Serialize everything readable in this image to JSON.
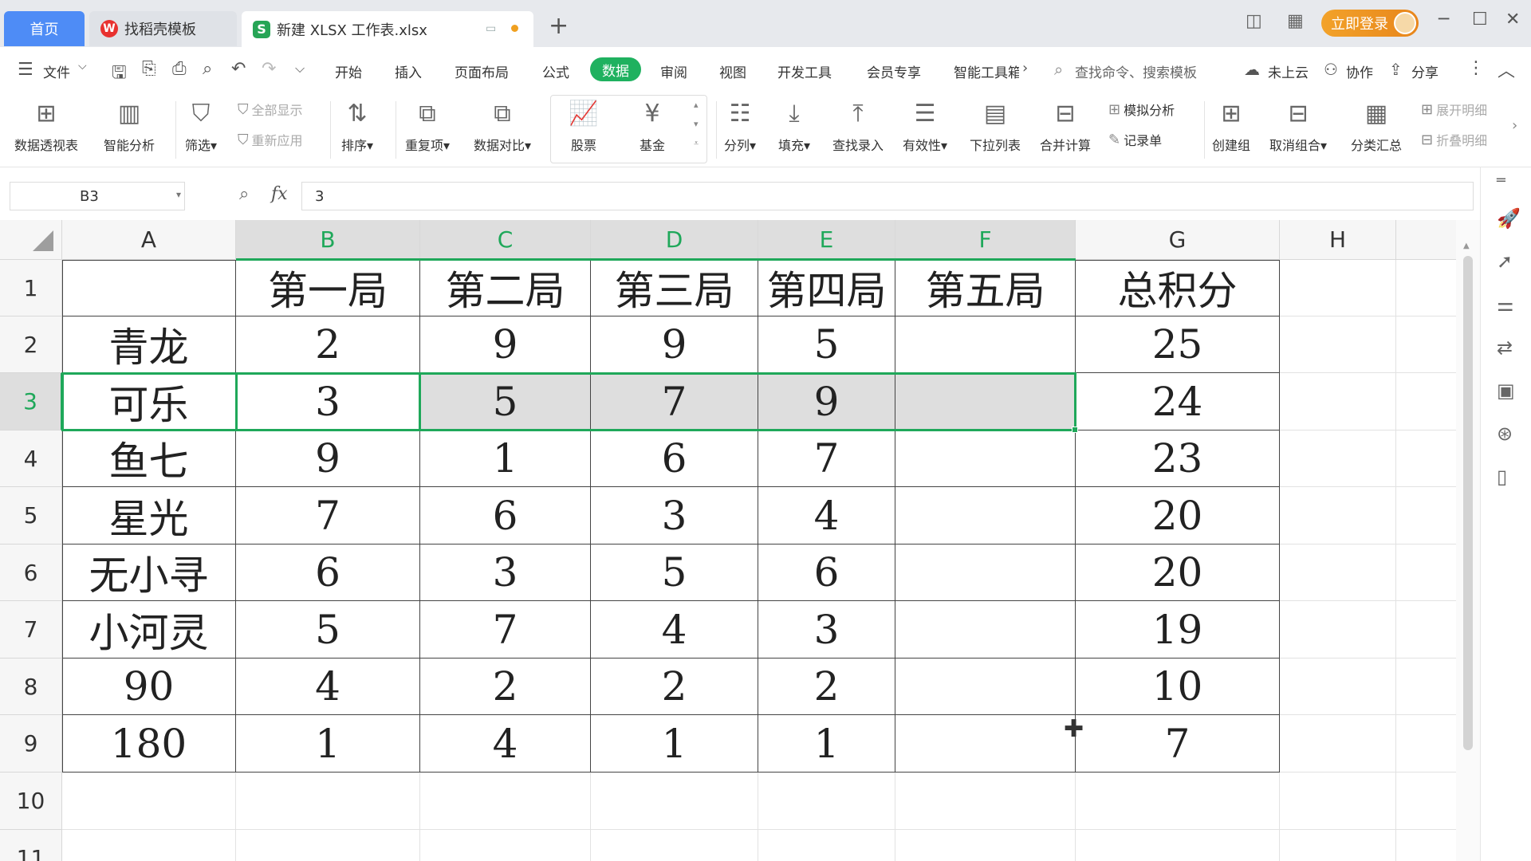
{
  "tabs": {
    "home": "首页",
    "template": "找稻壳模板",
    "document": "新建 XLSX 工作表.xlsx",
    "add": "+"
  },
  "topbar": {
    "login": "立即登录"
  },
  "menu": {
    "file": "文件",
    "items": [
      "开始",
      "插入",
      "页面布局",
      "公式",
      "数据",
      "审阅",
      "视图",
      "开发工具",
      "会员专享",
      "智能工具箱"
    ],
    "active": "数据",
    "search": "查找命令、搜索模板",
    "cloud": "未上云",
    "collab": "协作",
    "share": "分享"
  },
  "ribbon": {
    "pivot": "数据透视表",
    "smart_analysis": "智能分析",
    "filter": "筛选",
    "show_all": "全部显示",
    "reapply": "重新应用",
    "sort": "排序",
    "duplicates": "重复项",
    "compare": "数据对比",
    "stock": "股票",
    "fund": "基金",
    "split": "分列",
    "fill": "填充",
    "lookup": "查找录入",
    "validity": "有效性",
    "dropdown": "下拉列表",
    "consolidate": "合并计算",
    "simulate": "模拟分析",
    "record": "记录单",
    "create_group": "创建组",
    "ungroup": "取消组合",
    "subtotal": "分类汇总",
    "expand": "展开明细",
    "collapse": "折叠明细"
  },
  "formula_bar": {
    "name_box": "B3",
    "fx": "fx",
    "value": "3"
  },
  "sheet": {
    "columns": [
      "A",
      "B",
      "C",
      "D",
      "E",
      "F",
      "G",
      "H"
    ],
    "row_numbers": [
      "1",
      "2",
      "3",
      "4",
      "5",
      "6",
      "7",
      "8",
      "9",
      "10",
      "11"
    ],
    "rows": [
      [
        "",
        "第一局",
        "第二局",
        "第三局",
        "第四局",
        "第五局",
        "总积分"
      ],
      [
        "青龙",
        "2",
        "9",
        "9",
        "5",
        "",
        "25"
      ],
      [
        "可乐",
        "3",
        "5",
        "7",
        "9",
        "",
        "24"
      ],
      [
        "鱼七",
        "9",
        "1",
        "6",
        "7",
        "",
        "23"
      ],
      [
        "星光",
        "7",
        "6",
        "3",
        "4",
        "",
        "20"
      ],
      [
        "无小寻",
        "6",
        "3",
        "5",
        "6",
        "",
        "20"
      ],
      [
        "小河灵",
        "5",
        "7",
        "4",
        "3",
        "",
        "19"
      ],
      [
        "90",
        "4",
        "2",
        "2",
        "2",
        "",
        "10"
      ],
      [
        "180",
        "1",
        "4",
        "1",
        "1",
        "",
        "7"
      ]
    ],
    "selected_cell": "B3",
    "selected_range": "B3:F3"
  }
}
